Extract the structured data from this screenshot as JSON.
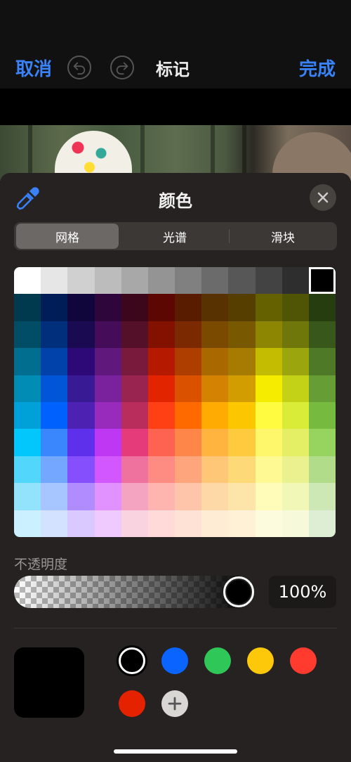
{
  "topbar": {
    "cancel_label": "取消",
    "title": "标记",
    "done_label": "完成",
    "undo_icon": "undo-icon",
    "redo_icon": "redo-icon"
  },
  "color_picker": {
    "title": "颜色",
    "eyedropper_icon": "eyedropper-icon",
    "close_icon": "close-icon",
    "tabs": [
      {
        "label": "网格",
        "selected": true
      },
      {
        "label": "光谱",
        "selected": false
      },
      {
        "label": "滑块",
        "selected": false
      }
    ],
    "grid": {
      "columns": 12,
      "rows": 10,
      "selected_color": "#000000",
      "colors": [
        [
          "#ffffff",
          "#e6e6e6",
          "#d0d0d0",
          "#bcbcbc",
          "#a8a8a8",
          "#949494",
          "#808080",
          "#6b6b6b",
          "#575757",
          "#434343",
          "#2e2e2e",
          "#000000"
        ],
        [
          "#003a4f",
          "#011d57",
          "#11063c",
          "#2e063c",
          "#3c071b",
          "#5c0701",
          "#5a1c00",
          "#583200",
          "#563d00",
          "#666100",
          "#4f5504",
          "#263e0f"
        ],
        [
          "#004d65",
          "#012f7b",
          "#1a0a52",
          "#450d59",
          "#551029",
          "#831100",
          "#7b2900",
          "#7a4a00",
          "#785800",
          "#8c8602",
          "#6f760a",
          "#38571a"
        ],
        [
          "#016e8f",
          "#0042a9",
          "#2c0977",
          "#61187c",
          "#791a3d",
          "#b51a00",
          "#ad3e00",
          "#a96800",
          "#a67b01",
          "#c4bc00",
          "#9ba50e",
          "#4e7a27"
        ],
        [
          "#008cb4",
          "#0056d6",
          "#371a94",
          "#7a219e",
          "#99244f",
          "#e22400",
          "#da5100",
          "#d38301",
          "#d19d01",
          "#f5ec00",
          "#c3d117",
          "#669d34"
        ],
        [
          "#00a1d8",
          "#0061fd",
          "#4d22b2",
          "#982abc",
          "#b92d5d",
          "#ff4015",
          "#ff6a00",
          "#ffab01",
          "#fdc700",
          "#fefb41",
          "#d9ec37",
          "#76bb40"
        ],
        [
          "#01c7fc",
          "#3a87fd",
          "#5e30eb",
          "#be38f3",
          "#e63b7a",
          "#fe6250",
          "#fe8648",
          "#feb43f",
          "#fecb3e",
          "#fff76b",
          "#e4ef65",
          "#96d35f"
        ],
        [
          "#52d6fc",
          "#74a7ff",
          "#864ffd",
          "#d357fe",
          "#ee719e",
          "#ff8c82",
          "#fea57d",
          "#fec777",
          "#fed977",
          "#fff994",
          "#eaf28f",
          "#b1dd8b"
        ],
        [
          "#93e3fc",
          "#a7c6ff",
          "#b18cfe",
          "#e292fe",
          "#f4a4c0",
          "#ffb5af",
          "#ffc5ab",
          "#fed9a8",
          "#fde4a8",
          "#fffbb9",
          "#f1f7b7",
          "#cde8b5"
        ],
        [
          "#cbf0ff",
          "#d3e2ff",
          "#d9c9fe",
          "#efcaff",
          "#f9d3e0",
          "#ffdad8",
          "#ffe2d6",
          "#feecd4",
          "#fef1d5",
          "#fdfbdd",
          "#f6fadb",
          "#deeed4"
        ]
      ]
    },
    "opacity": {
      "label": "不透明度",
      "value": 1.0,
      "value_text": "100%"
    },
    "current_color": "#000000",
    "swatches": [
      {
        "name": "black",
        "color": "#000000",
        "selected": true
      },
      {
        "name": "blue",
        "color": "#0a64ff"
      },
      {
        "name": "green",
        "color": "#30c759"
      },
      {
        "name": "yellow",
        "color": "#fec80a"
      },
      {
        "name": "red",
        "color": "#ff3b30"
      },
      {
        "name": "dark-red",
        "color": "#e52200"
      }
    ],
    "add_swatch_icon": "plus-icon"
  }
}
